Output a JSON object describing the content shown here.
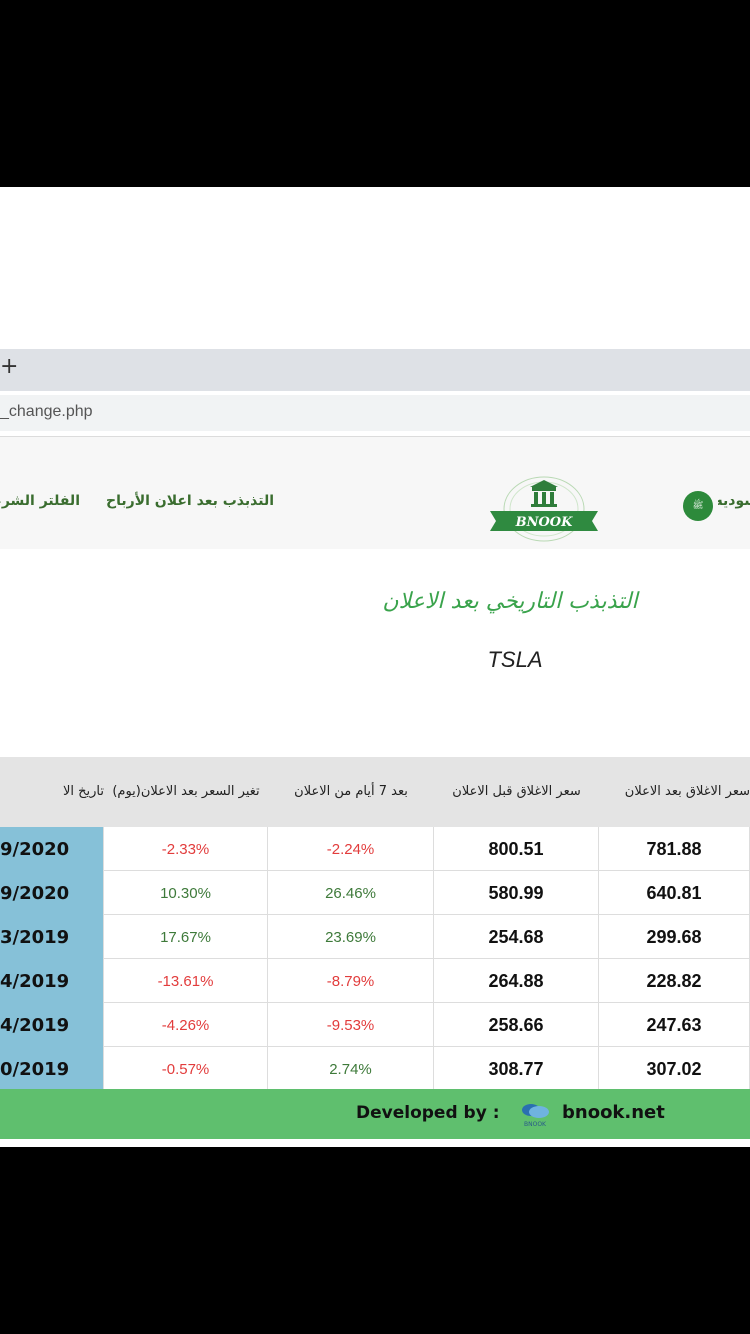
{
  "browser": {
    "newtab_glyph": "+",
    "url": "_change.php"
  },
  "nav": {
    "items": [
      {
        "label": "التذبذب بعد اعلان الأرباح"
      },
      {
        "label": "الفلتر الشرعي"
      },
      {
        "label": "سوديه"
      }
    ],
    "logo_text": "BNOOK",
    "flag_text": "ﷺ"
  },
  "page": {
    "heading": "التذبذب التاريخي بعد الاعلان",
    "ticker": "TSLA"
  },
  "table": {
    "headers": {
      "close_after": "سعر الاغلاق بعد الاعلان",
      "close_before": "سعر الاغلاق قبل الاعلان",
      "after7": "بعد 7 أيام من الاعلان",
      "day_change": "تغير السعر بعد الاعلان(يوم)",
      "date": "تاريخ الا"
    },
    "rows": [
      {
        "date": "9/2020",
        "day_change": "-2.33%",
        "after7": "-2.24%",
        "close_before": "800.51",
        "close_after": "781.88"
      },
      {
        "date": "9/2020",
        "day_change": "10.30%",
        "after7": "26.46%",
        "close_before": "580.99",
        "close_after": "640.81"
      },
      {
        "date": "3/2019",
        "day_change": "17.67%",
        "after7": "23.69%",
        "close_before": "254.68",
        "close_after": "299.68"
      },
      {
        "date": "4/2019",
        "day_change": "-13.61%",
        "after7": "-8.79%",
        "close_before": "264.88",
        "close_after": "228.82"
      },
      {
        "date": "4/2019",
        "day_change": "-4.26%",
        "after7": "-9.53%",
        "close_before": "258.66",
        "close_after": "247.63"
      },
      {
        "date": "0/2019",
        "day_change": "-0.57%",
        "after7": "2.74%",
        "close_before": "308.77",
        "close_after": "307.02"
      }
    ]
  },
  "footer": {
    "developed_by": "Developed by :",
    "mini_logo_text": "BNOOK",
    "site": "bnook.net"
  },
  "colors": {
    "green_accent": "#3a6d2f",
    "date_cell": "#86c1d8",
    "footer_bg": "#5fbf6e",
    "negative": "#e23c3c",
    "positive": "#3e7a3a"
  }
}
